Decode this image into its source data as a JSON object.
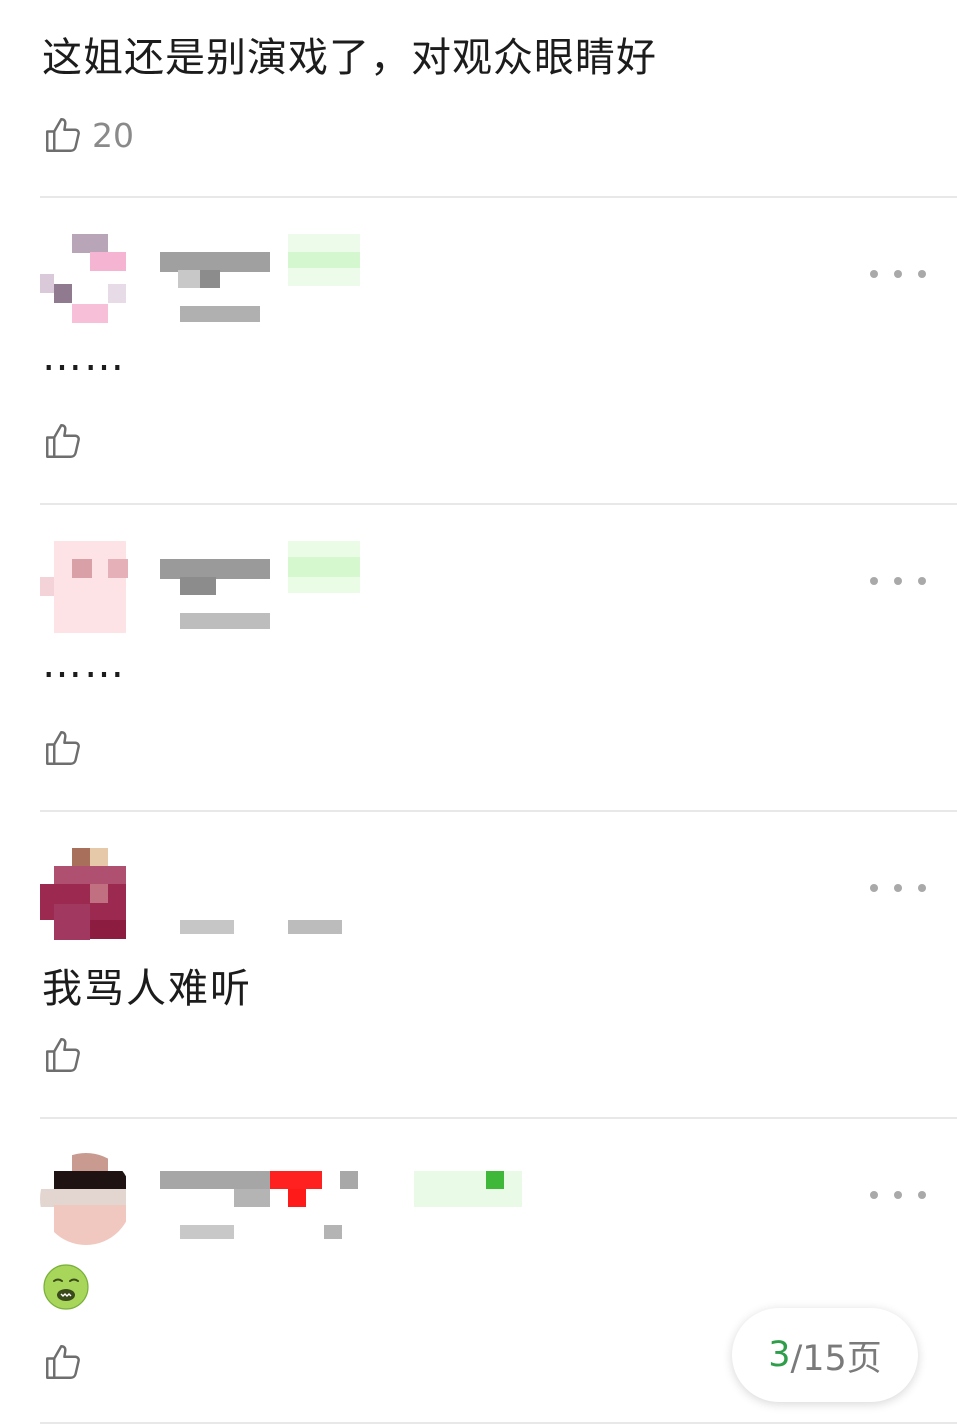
{
  "top_comment": {
    "text": "这姐还是别演戏了，对观众眼睛好",
    "likes": "20"
  },
  "replies": [
    {
      "text": "……",
      "has_emoji": false
    },
    {
      "text": "……",
      "has_emoji": false
    },
    {
      "text": "我骂人难听",
      "has_emoji": false
    },
    {
      "text": "",
      "has_emoji": true,
      "emoji": "nauseated-face"
    }
  ],
  "pager": {
    "current": "3",
    "total": "/15页"
  },
  "colors": {
    "accent": "#2e9e4a",
    "icon": "#8a8a8a",
    "divider": "#e8e8e8"
  }
}
